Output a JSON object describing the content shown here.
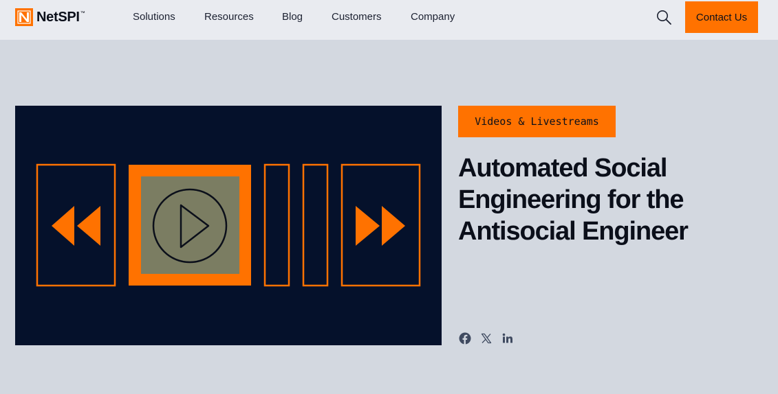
{
  "header": {
    "logo": {
      "name": "NetSPI",
      "tm": "™",
      "icon": "netspi-logo-icon"
    },
    "nav": [
      {
        "label": "Solutions"
      },
      {
        "label": "Resources"
      },
      {
        "label": "Blog"
      },
      {
        "label": "Customers"
      },
      {
        "label": "Company"
      }
    ],
    "search_icon": "search-icon",
    "contact_label": "Contact Us"
  },
  "media": {
    "icons": [
      "rewind-icon",
      "play-icon",
      "fast-forward-icon"
    ]
  },
  "article": {
    "category": "Videos & Livestreams",
    "title": "Automated Social Engineering for the Antisocial Engineer"
  },
  "share": {
    "icons": [
      "facebook-icon",
      "x-icon",
      "linkedin-icon"
    ]
  },
  "colors": {
    "accent": "#ff7200",
    "background": "#d3d8e0",
    "header_bg": "#e9ebf0",
    "video_bg": "#05112b",
    "text": "#0b0f1a"
  }
}
